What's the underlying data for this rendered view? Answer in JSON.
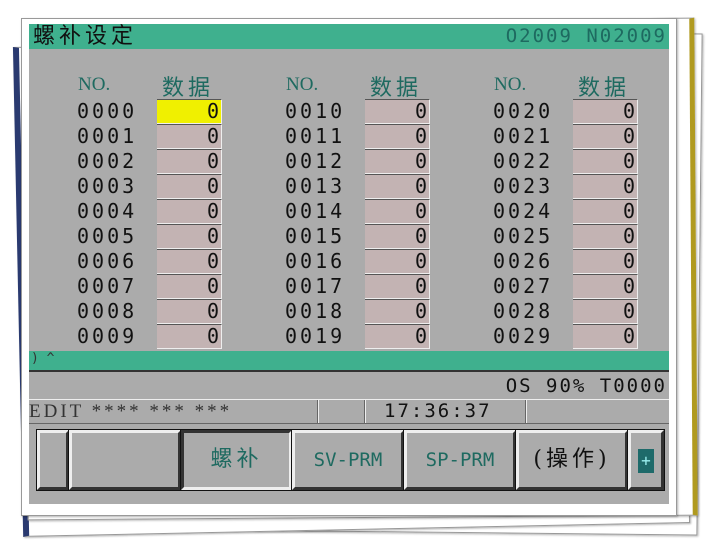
{
  "header": {
    "title": "螺补设定",
    "program": "O2009 N02009"
  },
  "columns": [
    {
      "no_label": "NO.",
      "data_label": "数据",
      "start": 0
    },
    {
      "no_label": "NO.",
      "data_label": "数据",
      "start": 10
    },
    {
      "no_label": "NO.",
      "data_label": "数据",
      "start": 20
    }
  ],
  "entries": [
    {
      "no": "0000",
      "value": "0",
      "selected": true
    },
    {
      "no": "0001",
      "value": "0"
    },
    {
      "no": "0002",
      "value": "0"
    },
    {
      "no": "0003",
      "value": "0"
    },
    {
      "no": "0004",
      "value": "0"
    },
    {
      "no": "0005",
      "value": "0"
    },
    {
      "no": "0006",
      "value": "0"
    },
    {
      "no": "0007",
      "value": "0"
    },
    {
      "no": "0008",
      "value": "0"
    },
    {
      "no": "0009",
      "value": "0"
    },
    {
      "no": "0010",
      "value": "0"
    },
    {
      "no": "0011",
      "value": "0"
    },
    {
      "no": "0012",
      "value": "0"
    },
    {
      "no": "0013",
      "value": "0"
    },
    {
      "no": "0014",
      "value": "0"
    },
    {
      "no": "0015",
      "value": "0"
    },
    {
      "no": "0016",
      "value": "0"
    },
    {
      "no": "0017",
      "value": "0"
    },
    {
      "no": "0018",
      "value": "0"
    },
    {
      "no": "0019",
      "value": "0"
    },
    {
      "no": "0020",
      "value": "0"
    },
    {
      "no": "0021",
      "value": "0"
    },
    {
      "no": "0022",
      "value": "0"
    },
    {
      "no": "0023",
      "value": "0"
    },
    {
      "no": "0024",
      "value": "0"
    },
    {
      "no": "0025",
      "value": "0"
    },
    {
      "no": "0026",
      "value": "0"
    },
    {
      "no": "0027",
      "value": "0"
    },
    {
      "no": "0028",
      "value": "0"
    },
    {
      "no": "0029",
      "value": "0"
    }
  ],
  "command_line": ") ^",
  "os_line": "OS 90% T0000",
  "status": {
    "mode": "EDIT **** *** ***",
    "time": "17:36:37"
  },
  "softkeys": {
    "k3": "螺补",
    "k4": "SV-PRM",
    "k5": "SP-PRM",
    "k6": "(操作)",
    "next": "+"
  },
  "colors": {
    "title_bar": "#3fb08e",
    "screen_bg": "#ababab",
    "cell": "#c3b3b3",
    "selected_cell": "#f0f000"
  }
}
